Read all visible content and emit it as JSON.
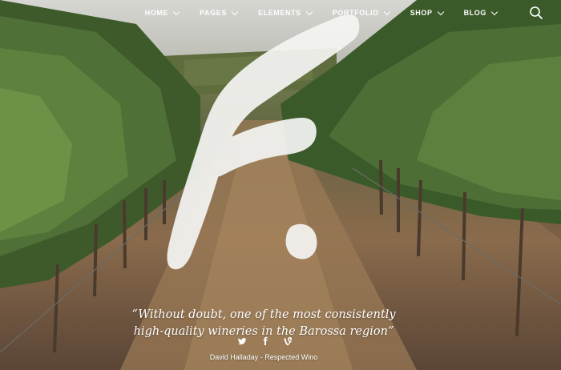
{
  "nav": {
    "items": [
      {
        "label": "HOME",
        "icon": "chevron-down-icon"
      },
      {
        "label": "PAGES",
        "icon": "chevron-down-icon"
      },
      {
        "label": "ELEMENTS",
        "icon": "chevron-down-icon"
      },
      {
        "label": "PORTFOLIO",
        "icon": "chevron-down-icon"
      },
      {
        "label": "SHOP",
        "icon": "chevron-down-icon"
      },
      {
        "label": "BLOG",
        "icon": "chevron-down-icon"
      }
    ],
    "search_icon": "search-icon"
  },
  "hero": {
    "logo_letter": "f.",
    "logo_color": "#f4f4f2",
    "quote_line1": "“Without doubt, one of the most consistently",
    "quote_line2": "high-quality wineries in the Barossa region”",
    "social_icons": [
      "twitter-icon",
      "facebook-icon",
      "vine-icon"
    ],
    "author": "David Halladay - Respected Wino"
  }
}
